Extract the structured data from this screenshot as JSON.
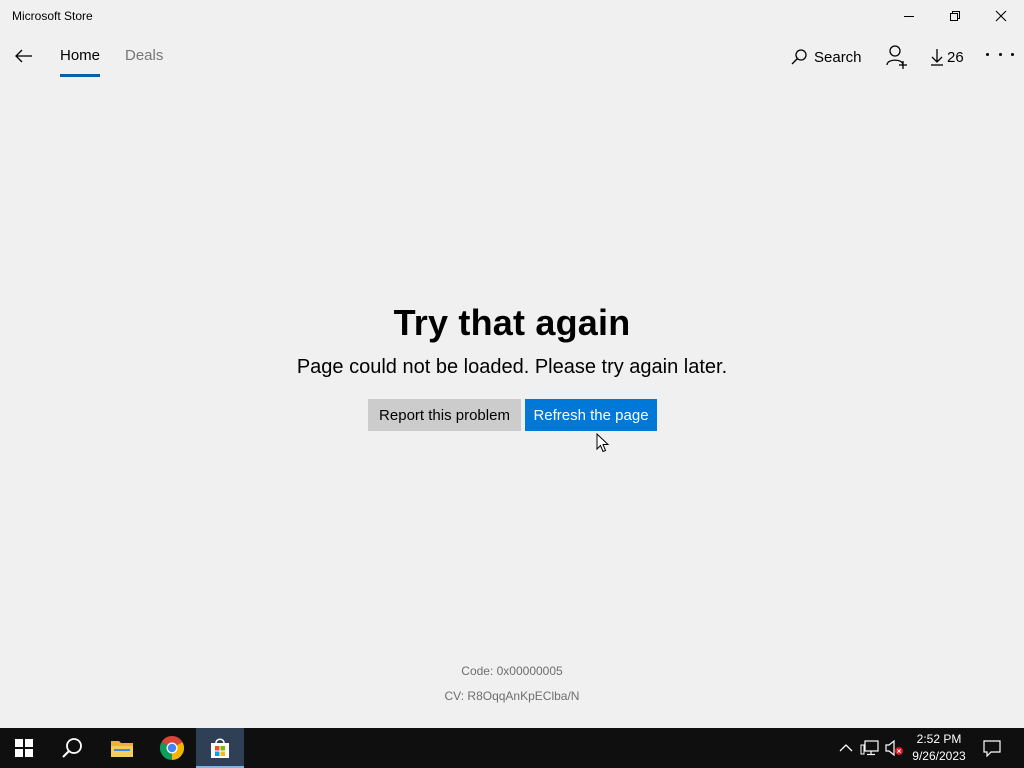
{
  "window": {
    "title": "Microsoft Store",
    "controls": [
      "minimize",
      "restore",
      "close"
    ]
  },
  "nav": {
    "tabs": [
      {
        "label": "Home",
        "active": true
      },
      {
        "label": "Deals",
        "active": false
      }
    ],
    "search_label": "Search",
    "downloads_count": "26",
    "accent": "#0063b1"
  },
  "error": {
    "title": "Try that again",
    "message": "Page could not be loaded. Please try again later.",
    "report_label": "Report this problem",
    "refresh_label": "Refresh the page",
    "code": "Code: 0x00000005",
    "cv": "CV: R8OqqAnKpEClba/N",
    "refresh_color": "#0078d7"
  },
  "taskbar": {
    "apps": [
      "start-icon",
      "search-icon",
      "file-explorer-icon",
      "chrome-icon",
      "store-icon"
    ],
    "time": "2:52 PM",
    "date": "9/26/2023"
  }
}
